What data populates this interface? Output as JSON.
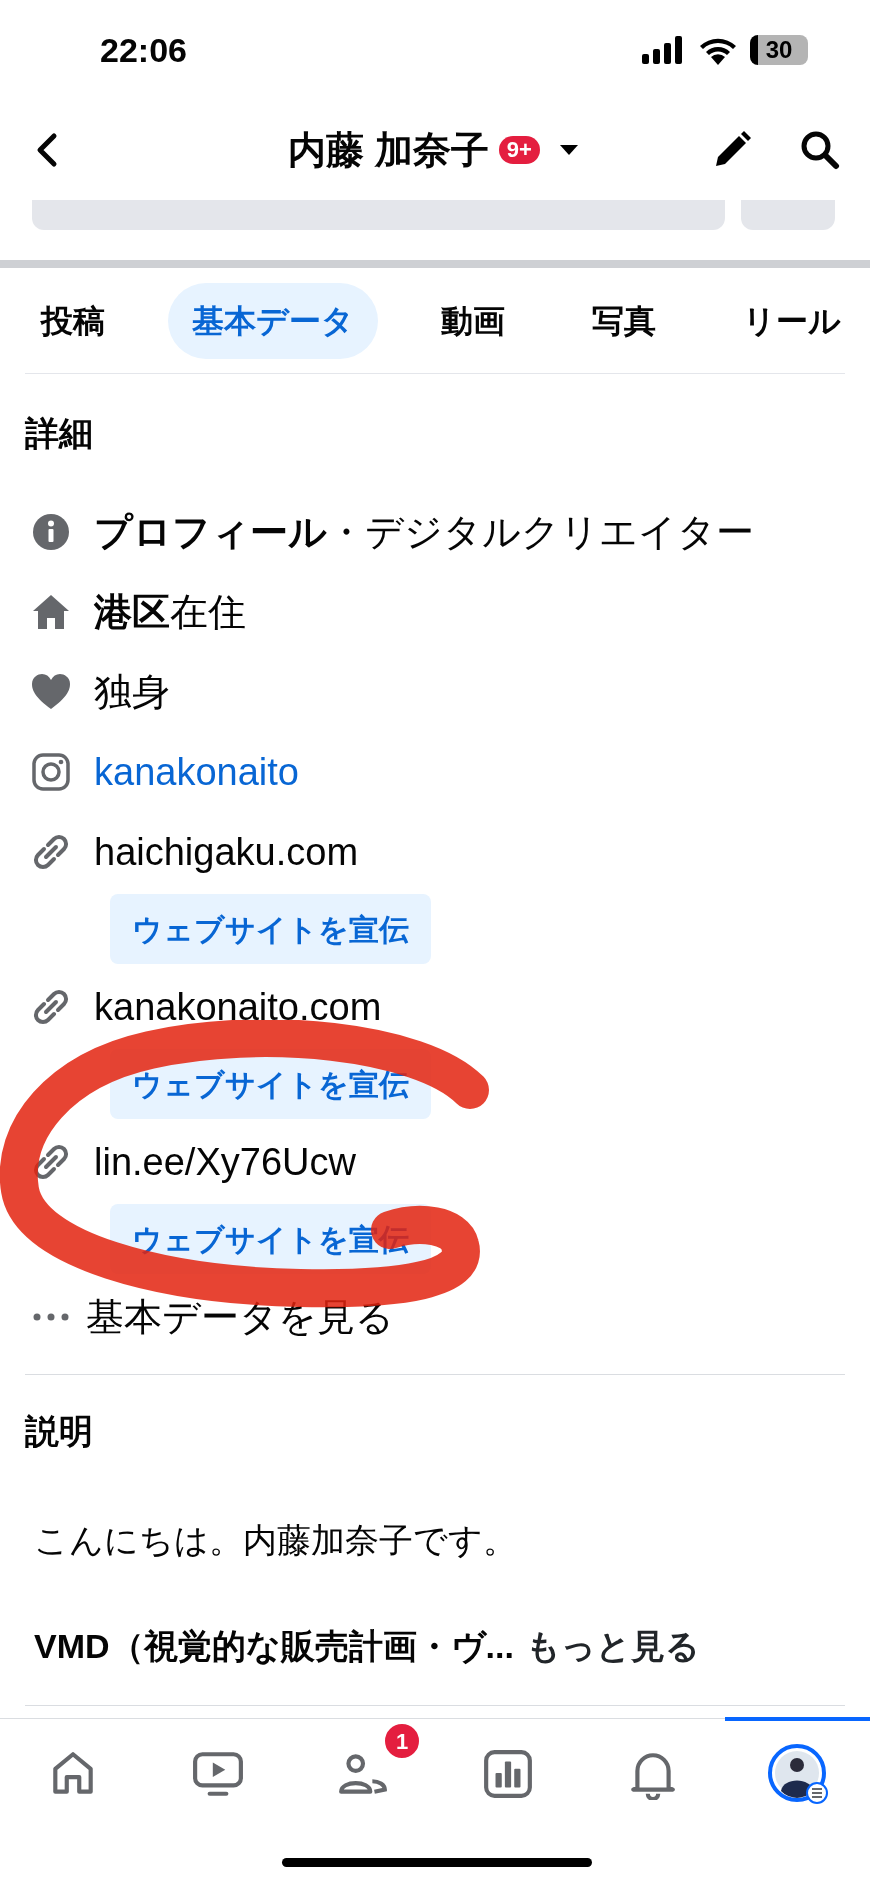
{
  "status_bar": {
    "time": "22:06",
    "battery": "30"
  },
  "header": {
    "title": "内藤 加奈子",
    "badge": "9+"
  },
  "tabs": [
    {
      "label": "投稿",
      "selected": false
    },
    {
      "label": "基本データ",
      "selected": true
    },
    {
      "label": "動画",
      "selected": false
    },
    {
      "label": "写真",
      "selected": false
    },
    {
      "label": "リール",
      "selected": false
    }
  ],
  "details": {
    "heading": "詳細",
    "items": [
      {
        "kind": "info",
        "text": "**プロフィール**・デジタルクリエイター"
      },
      {
        "kind": "home",
        "text": "**港区**在住"
      },
      {
        "kind": "heart",
        "text": "独身"
      },
      {
        "kind": "instagram",
        "text": "kanakonaito"
      },
      {
        "kind": "link",
        "text": "haichigaku.com",
        "button": "ウェブサイトを宣伝"
      },
      {
        "kind": "link",
        "text": "kanakonaito.com",
        "button": "ウェブサイトを宣伝"
      },
      {
        "kind": "link",
        "text": "lin.ee/Xy76Ucw",
        "button": "ウェブサイトを宣伝"
      },
      {
        "kind": "more",
        "text": "基本データを見る"
      }
    ]
  },
  "description": {
    "heading": "説明",
    "paragraphs": [
      "こんにちは。内藤加奈子です。",
      "VMD（視覚的な販売計画・ヴ..."
    ],
    "see_more": "もっと見る"
  },
  "bottom_nav": [
    {
      "kind": "home",
      "selected": false
    },
    {
      "kind": "video",
      "selected": false
    },
    {
      "kind": "friends",
      "selected": false,
      "badge": "1"
    },
    {
      "kind": "chart",
      "selected": false
    },
    {
      "kind": "bell",
      "selected": false
    },
    {
      "kind": "profile",
      "selected": true
    }
  ]
}
